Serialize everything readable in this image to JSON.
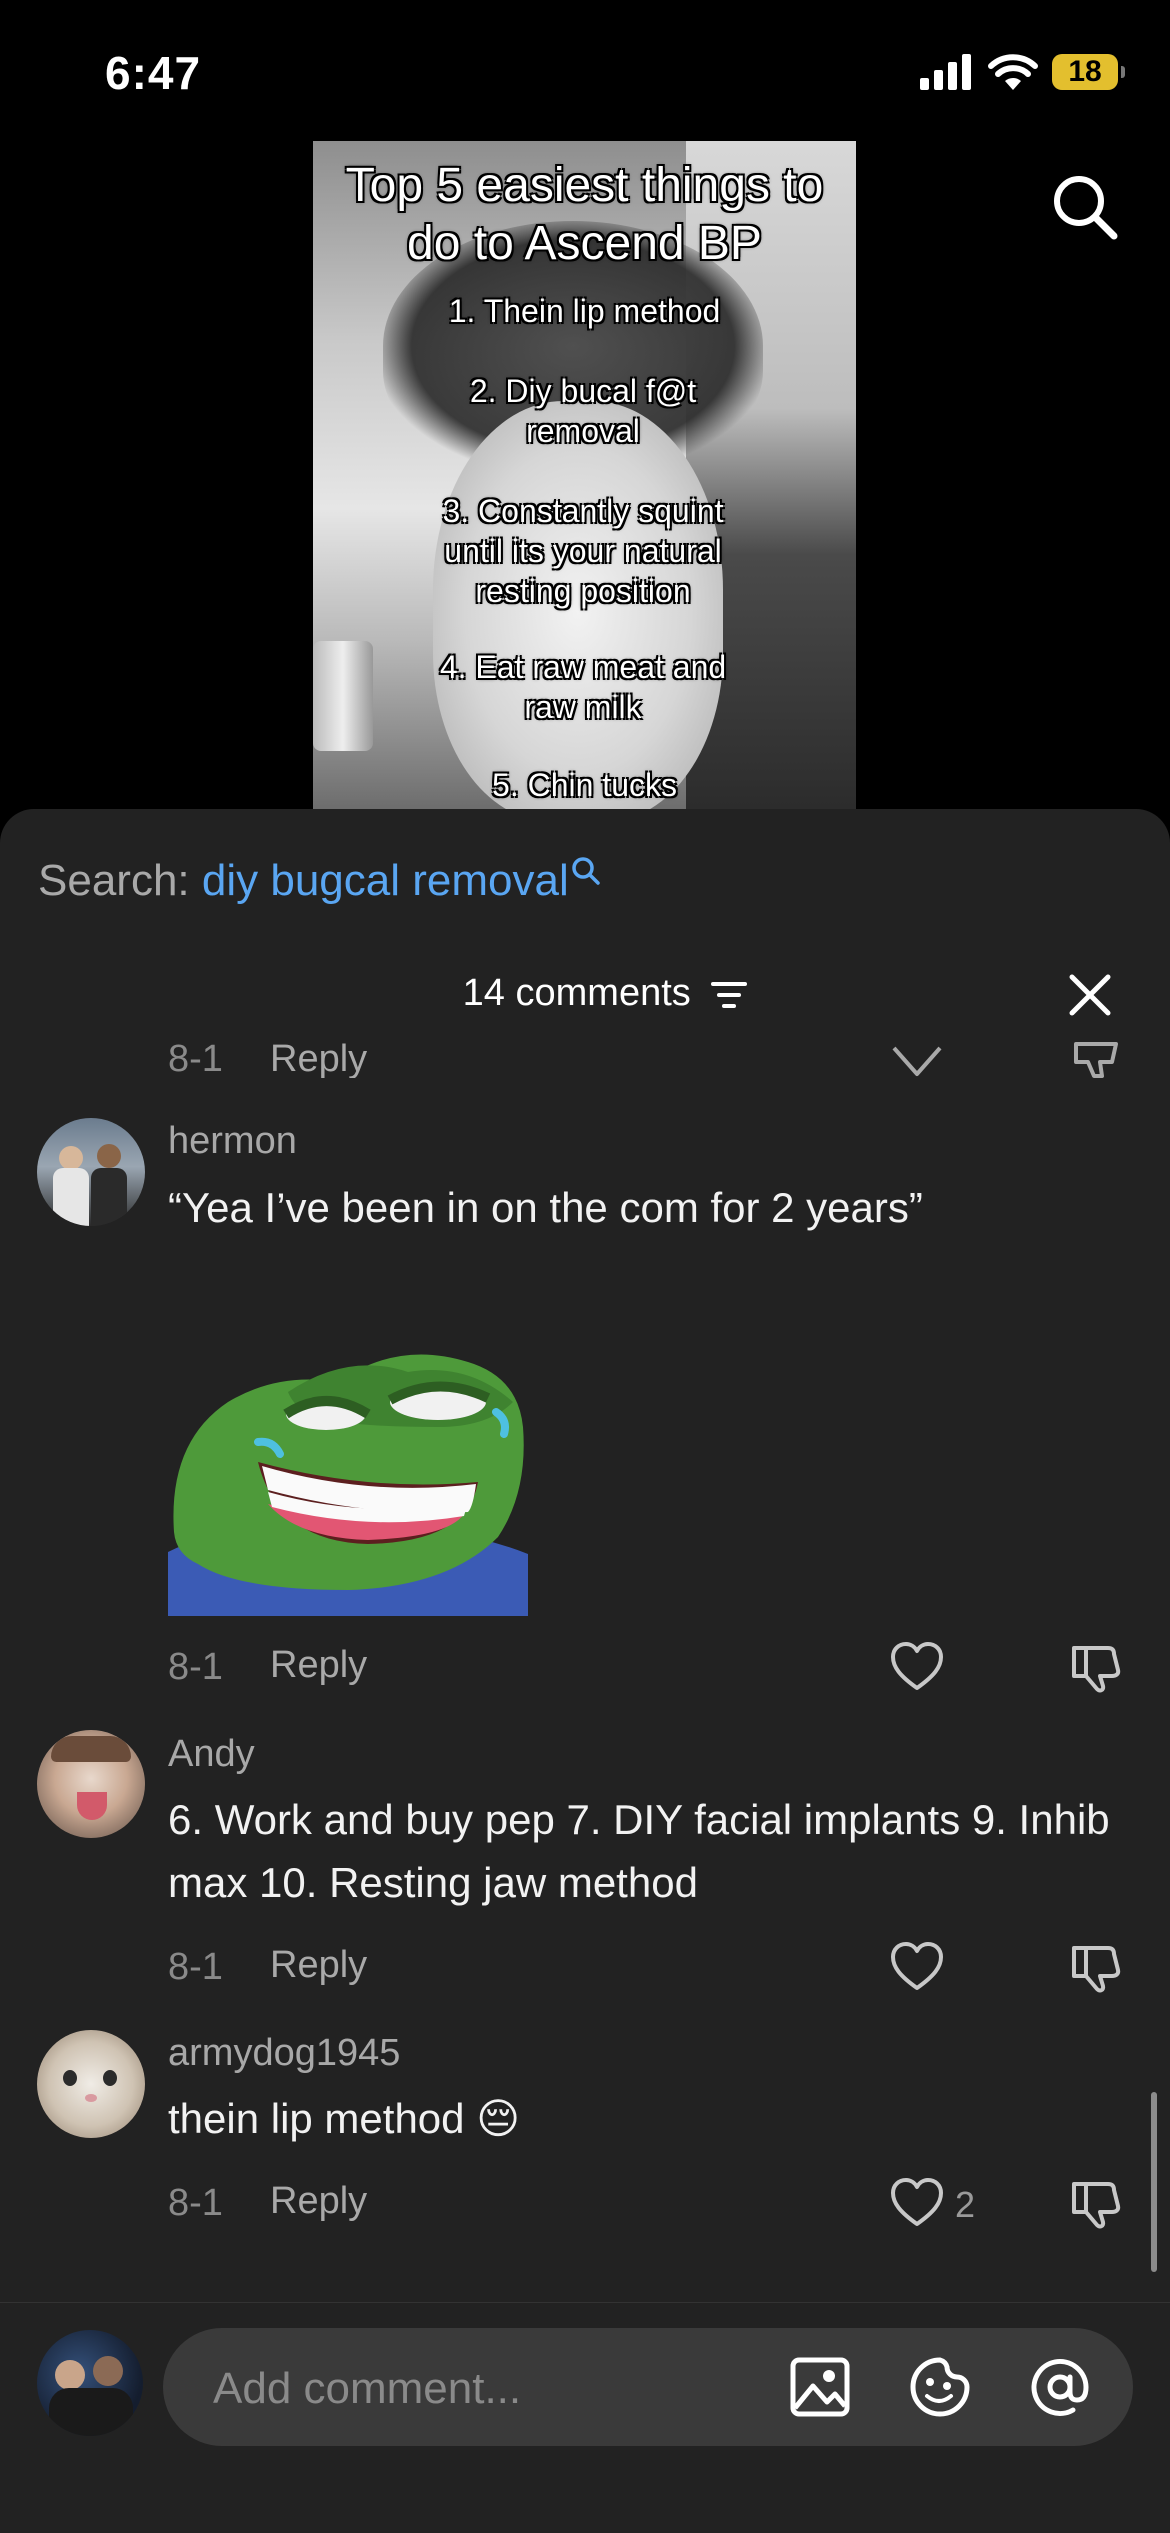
{
  "status_bar": {
    "time": "6:47",
    "battery": "18"
  },
  "video": {
    "title": "Top 5 easiest things to do to Ascend BP",
    "items": [
      "1. Thein lip method",
      "2. Diy bucal f@t removal",
      "3. Constantly squint until its your natural resting position",
      "4. Eat raw meat and raw milk",
      "5. Chin tucks"
    ]
  },
  "search": {
    "label": "Search:",
    "query": "diy bugcal removal"
  },
  "comments_header": {
    "count_label": "14 comments"
  },
  "comments": [
    {
      "username": "hermon",
      "text": "“Yea I’ve been in on the com for 2 years”",
      "sticker": "pepe-laughing-sticker",
      "date": "8-1",
      "reply_label": "Reply",
      "likes": ""
    },
    {
      "username": "Andy",
      "text": "6. Work and buy pep 7. DIY facial implants 9. Inhib max 10. Resting jaw method",
      "date": "8-1",
      "reply_label": "Reply",
      "likes": ""
    },
    {
      "username": "armydog1945",
      "text": "thein lip method 😔",
      "date": "8-1",
      "reply_label": "Reply",
      "likes": "2"
    }
  ],
  "partial_top": {
    "date": "8-1",
    "reply_label": "Reply"
  },
  "composer": {
    "placeholder": "Add comment..."
  },
  "colors": {
    "sheet_bg": "#222222",
    "search_accent": "#5aa6f2",
    "battery": "#e3bf2e"
  }
}
